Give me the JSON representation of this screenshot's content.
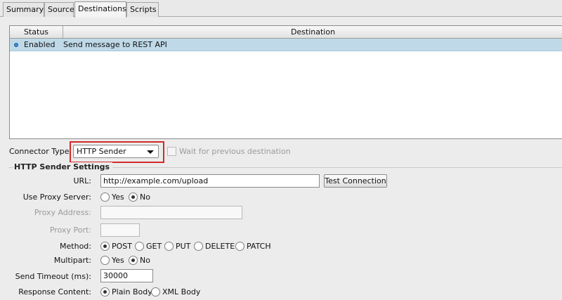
{
  "tabs": [
    "Summary",
    "Source",
    "Destinations",
    "Scripts"
  ],
  "active_tab": "Destinations",
  "table": {
    "columns": [
      "Status",
      "Destination"
    ],
    "rows": [
      {
        "status": "Enabled",
        "destination": "Send message to REST API"
      }
    ]
  },
  "connector": {
    "label": "Connector Type:",
    "value": "HTTP Sender",
    "wait_label": "Wait for previous destination"
  },
  "settings": {
    "title": "HTTP Sender Settings",
    "url_label": "URL:",
    "url_value": "http://example.com/upload",
    "test_button": "Test Connection",
    "proxy_label": "Use Proxy Server:",
    "proxy_address_label": "Proxy Address:",
    "proxy_port_label": "Proxy Port:",
    "method_label": "Method:",
    "multipart_label": "Multipart:",
    "timeout_label": "Send Timeout (ms):",
    "timeout_value": "30000",
    "response_label": "Response Content:",
    "yes": "Yes",
    "no": "No",
    "methods": [
      "POST",
      "GET",
      "PUT",
      "DELETE",
      "PATCH"
    ],
    "response_options": [
      "Plain Body",
      "XML Body"
    ],
    "selected": {
      "proxy": "No",
      "method": "POST",
      "multipart": "No",
      "response": "Plain Body"
    }
  },
  "colors": {
    "selected_row": "#bfd9e8",
    "highlight_border": "#d42a2a",
    "status_dot": "#3a8fd6"
  }
}
